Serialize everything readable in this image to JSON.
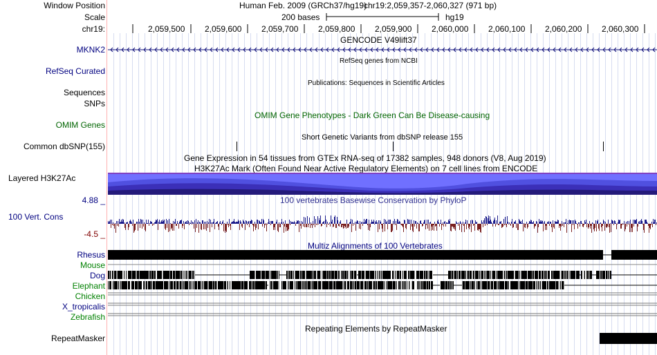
{
  "labels": {
    "window_position": "Window Position",
    "scale": "Scale",
    "chrom": "chr19:",
    "mknk2": "MKNK2",
    "refseq": "RefSeq Curated",
    "sequences": "Sequences",
    "snps": "SNPs",
    "omim_genes": "OMIM Genes",
    "common_dbsnp": "Common dbSNP(155)",
    "layered_h3k27ac": "Layered H3K27Ac",
    "cons_max": "4.88 _",
    "vert_cons": "100 Vert. Cons",
    "cons_min": "-4.5 _",
    "species": [
      "Rhesus",
      "Mouse",
      "Dog",
      "Elephant",
      "Chicken",
      "X_tropicalis",
      "Zebrafish"
    ],
    "repeatmasker": "RepeatMasker"
  },
  "header": {
    "assembly": "Human Feb. 2009 (GRCh37/hg19)",
    "position": "chr19:2,059,357-2,060,327 (971 bp)",
    "scale_text": "200 bases",
    "db": "hg19",
    "ticks": [
      "2,059,500",
      "2,059,600",
      "2,059,700",
      "2,059,800",
      "2,059,900",
      "2,060,000",
      "2,060,100",
      "2,060,200",
      "2,060,300"
    ]
  },
  "tracks": {
    "gencode": "GENCODE V49lift37",
    "refseq_title": "RefSeq genes from NCBI",
    "publications_title": "Publications: Sequences in Scientific Articles",
    "omim_title": "OMIM Gene Phenotypes - Dark Green Can Be Disease-causing",
    "dbsnp_title": "Short Genetic Variants from dbSNP release 155",
    "gtex_title": "Gene Expression in 54 tissues from GTEx RNA-seq of 17382 samples, 948 donors (V8, Aug 2019)",
    "h3k27ac_title": "H3K27Ac Mark (Often Found Near Active Regulatory Elements) on 7 cell lines from ENCODE",
    "phylop_title": "100 vertebrates Basewise Conservation by PhyloP",
    "multiz_title": "Multiz Alignments of 100 Vertebrates",
    "repeat_title": "Repeating Elements by RepeatMasker"
  },
  "colors": {
    "navy": "#000080",
    "dark_red": "#800000",
    "omim_green": "#006400",
    "species_green": "#008000",
    "gene_blue": "#0c0c78",
    "h3k27_purple": "#8040c0",
    "h3k27_fill": "#6060ff",
    "guide": "#cfd8ef"
  }
}
